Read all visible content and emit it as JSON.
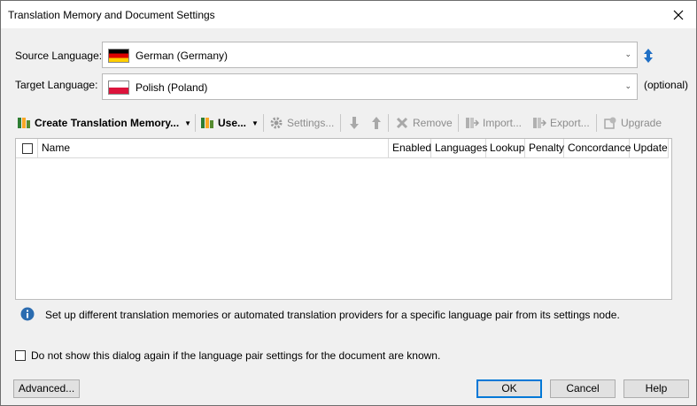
{
  "window": {
    "title": "Translation Memory and Document Settings"
  },
  "source": {
    "label": "Source Language:",
    "value": "German (Germany)",
    "flag": "de-flag"
  },
  "target": {
    "label": "Target Language:",
    "value": "Polish (Poland)",
    "flag": "pl-flag",
    "optional": "(optional)"
  },
  "toolbar": {
    "create": "Create Translation Memory...",
    "use": "Use...",
    "settings": "Settings...",
    "remove": "Remove",
    "import": "Import...",
    "export": "Export...",
    "upgrade": "Upgrade"
  },
  "grid": {
    "columns": [
      "Name",
      "Enabled",
      "Languages",
      "Lookup",
      "Penalty",
      "Concordance",
      "Update"
    ],
    "rows": []
  },
  "info": "Set up different translation memories or automated translation providers for a specific language pair from its settings node.",
  "dont_show": "Do not show this dialog again if the language pair settings for the document are known.",
  "buttons": {
    "advanced": "Advanced...",
    "ok": "OK",
    "cancel": "Cancel",
    "help": "Help"
  },
  "colors": {
    "accent": "#0078d7",
    "info": "#2b6cb0"
  }
}
